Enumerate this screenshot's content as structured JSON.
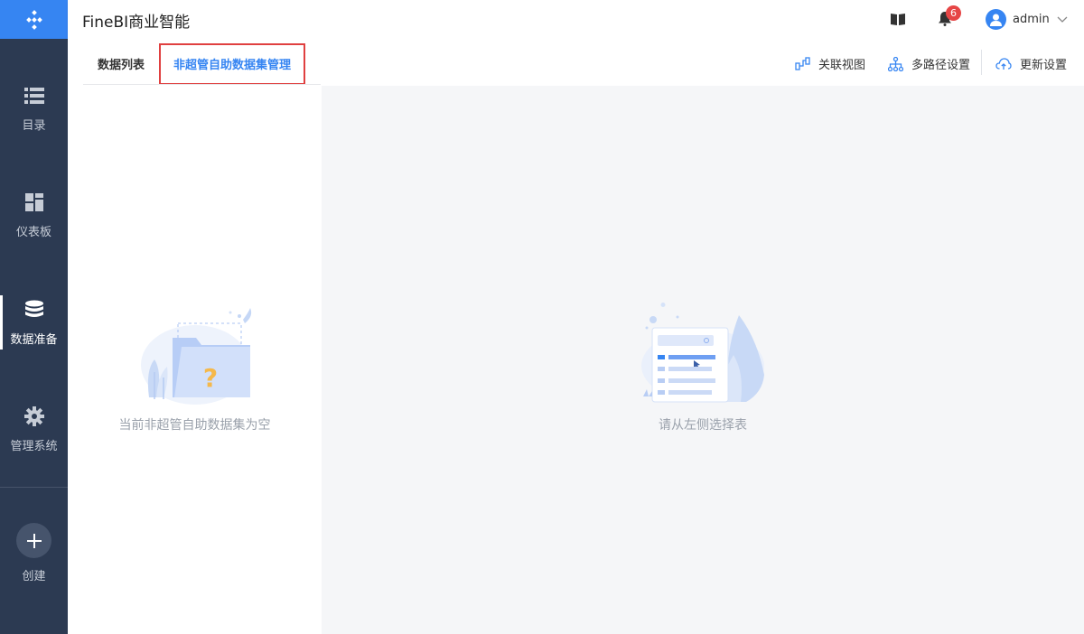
{
  "app": {
    "title": "FineBI商业智能"
  },
  "sidebar": {
    "items": [
      {
        "label": "目录",
        "icon": "list-icon"
      },
      {
        "label": "仪表板",
        "icon": "dashboard-icon"
      },
      {
        "label": "数据准备",
        "icon": "database-icon",
        "active": true
      },
      {
        "label": "管理系统",
        "icon": "gear-icon"
      }
    ],
    "create_label": "创建"
  },
  "header": {
    "notification_count": "6",
    "username": "admin"
  },
  "tabs": [
    {
      "label": "数据列表",
      "active": false
    },
    {
      "label": "非超管自助数据集管理",
      "active": true
    }
  ],
  "actions": [
    {
      "label": "关联视图",
      "icon": "relation-view-icon"
    },
    {
      "label": "多路径设置",
      "icon": "multi-path-icon"
    },
    {
      "label": "更新设置",
      "icon": "cloud-update-icon"
    }
  ],
  "left_panel": {
    "empty_text": "当前非超管自助数据集为空"
  },
  "right_panel": {
    "empty_text": "请从左侧选择表"
  },
  "colors": {
    "accent": "#3685f2",
    "sidebar_bg": "#2c3a52",
    "highlight_border": "#e04040",
    "badge": "#e64545"
  }
}
